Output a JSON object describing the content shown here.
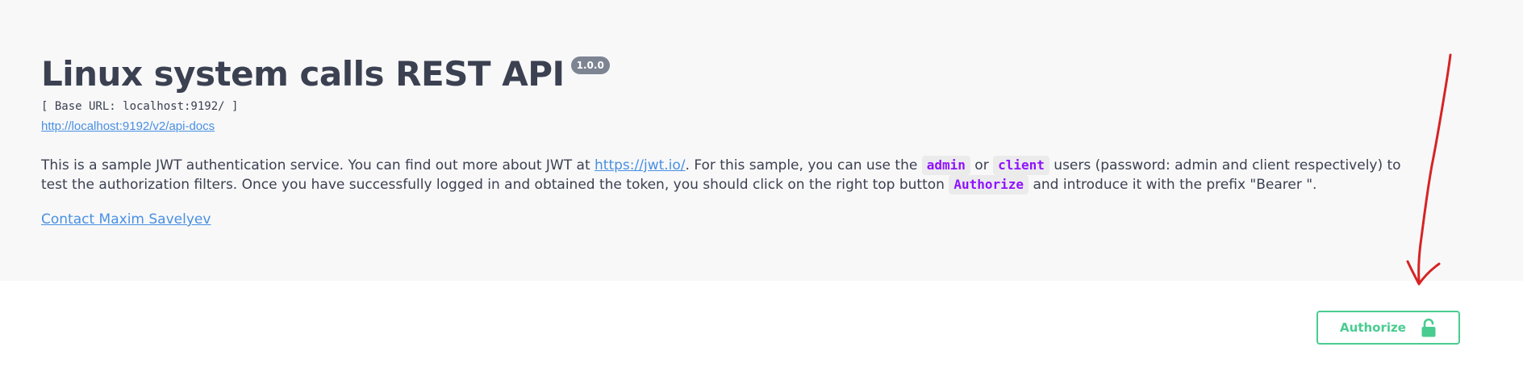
{
  "info": {
    "title": "Linux system calls REST API",
    "version": "1.0.0",
    "base_url": "[ Base URL: localhost:9192/ ]",
    "docs_url": "http://localhost:9192/v2/api-docs",
    "description": {
      "part1": "This is a sample JWT authentication service. You can find out more about JWT at ",
      "jwt_link": "https://jwt.io/",
      "part2": ". For this sample, you can use the ",
      "code_admin": "admin",
      "part3": " or ",
      "code_client": "client",
      "part4": " users (password: admin and client respectively) to test the authorization filters. Once you have successfully logged in and obtained the token, you should click on the right top button ",
      "code_authorize": "Authorize",
      "part5": " and introduce it with the prefix \"Bearer \"."
    },
    "contact_label": "Contact Maxim Savelyev"
  },
  "scheme_container": {
    "authorize_label": "Authorize",
    "lock_icon": "unlocked-padlock-icon"
  },
  "colors": {
    "authorize_green": "#49cc90",
    "link_blue": "#4990e2",
    "code_purple": "#9012fe",
    "annotation_red": "#d62424"
  }
}
